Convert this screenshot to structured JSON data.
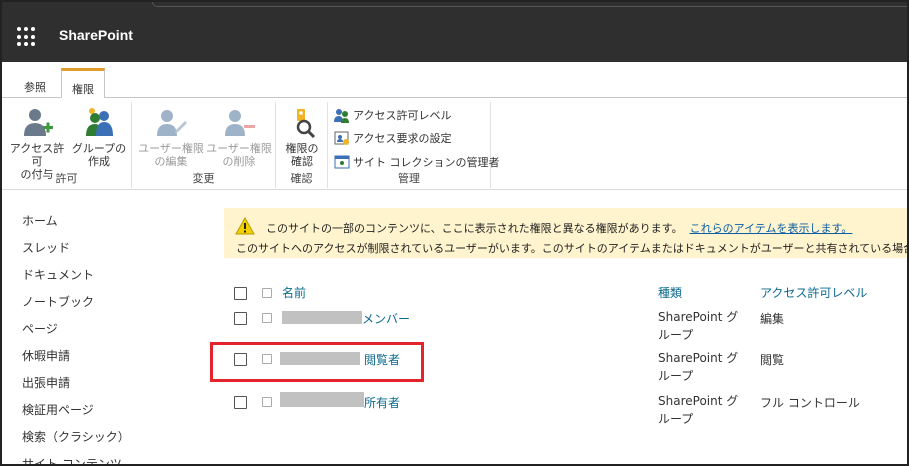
{
  "app": {
    "name": "SharePoint"
  },
  "ribbon_tabs": [
    {
      "label": "参照",
      "active": false
    },
    {
      "label": "権限",
      "active": true
    }
  ],
  "ribbon": {
    "groups": [
      {
        "label": "許可",
        "buttons": [
          {
            "label_l1": "アクセス許可",
            "label_l2": "の付与",
            "icon": "grant-permission-icon",
            "enabled": true
          },
          {
            "label_l1": "グループの",
            "label_l2": "作成",
            "icon": "create-group-icon",
            "enabled": true
          }
        ]
      },
      {
        "label": "変更",
        "buttons": [
          {
            "label_l1": "ユーザー権限",
            "label_l2": "の編集",
            "icon": "edit-user-permissions-icon",
            "enabled": false
          },
          {
            "label_l1": "ユーザー権限",
            "label_l2": "の削除",
            "icon": "remove-user-permissions-icon",
            "enabled": false
          }
        ]
      },
      {
        "label": "確認",
        "buttons": [
          {
            "label_l1": "権限の",
            "label_l2": "確認",
            "icon": "check-permissions-icon",
            "enabled": true
          }
        ]
      },
      {
        "label": "管理",
        "items": [
          {
            "label": "アクセス許可レベル",
            "icon": "permission-levels-icon"
          },
          {
            "label": "アクセス要求の設定",
            "icon": "access-request-settings-icon"
          },
          {
            "label": "サイト コレクションの管理者",
            "icon": "site-collection-admins-icon"
          }
        ]
      }
    ]
  },
  "leftnav": [
    "ホーム",
    "スレッド",
    "ドキュメント",
    "ノートブック",
    "ページ",
    "休暇申請",
    "出張申請",
    "検証用ページ",
    "検索（クラシック）",
    "サイト コンテンツ"
  ],
  "warning": {
    "line1": "このサイトの一部のコンテンツに、ここに表示された権限と異なる権限があります。",
    "line1_link": "これらのアイテムを表示します。",
    "line2": "このサイトへのアクセスが制限されているユーザーがいます。このサイトのアイテムまたはドキュメントがユーザーと共有されている場合は、アク"
  },
  "table": {
    "headers": {
      "name": "名前",
      "type": "種類",
      "permission": "アクセス許可レベル"
    },
    "rows": [
      {
        "name_suffix": "メンバー",
        "type_l1": "SharePoint グ",
        "type_l2": "ループ",
        "permission": "編集"
      },
      {
        "name_suffix": "閲覧者",
        "type_l1": "SharePoint グ",
        "type_l2": "ループ",
        "permission": "閲覧"
      },
      {
        "name_suffix": "所有者",
        "type_l1": "SharePoint グ",
        "type_l2": "ループ",
        "permission": "フル コントロール"
      }
    ]
  },
  "colors": {
    "accent_tab": "#e29c2b",
    "link": "#0b6a8e",
    "highlight": "#e3252b",
    "warning_bg": "#fff4ce",
    "suitebar": "#2f2f2f"
  }
}
